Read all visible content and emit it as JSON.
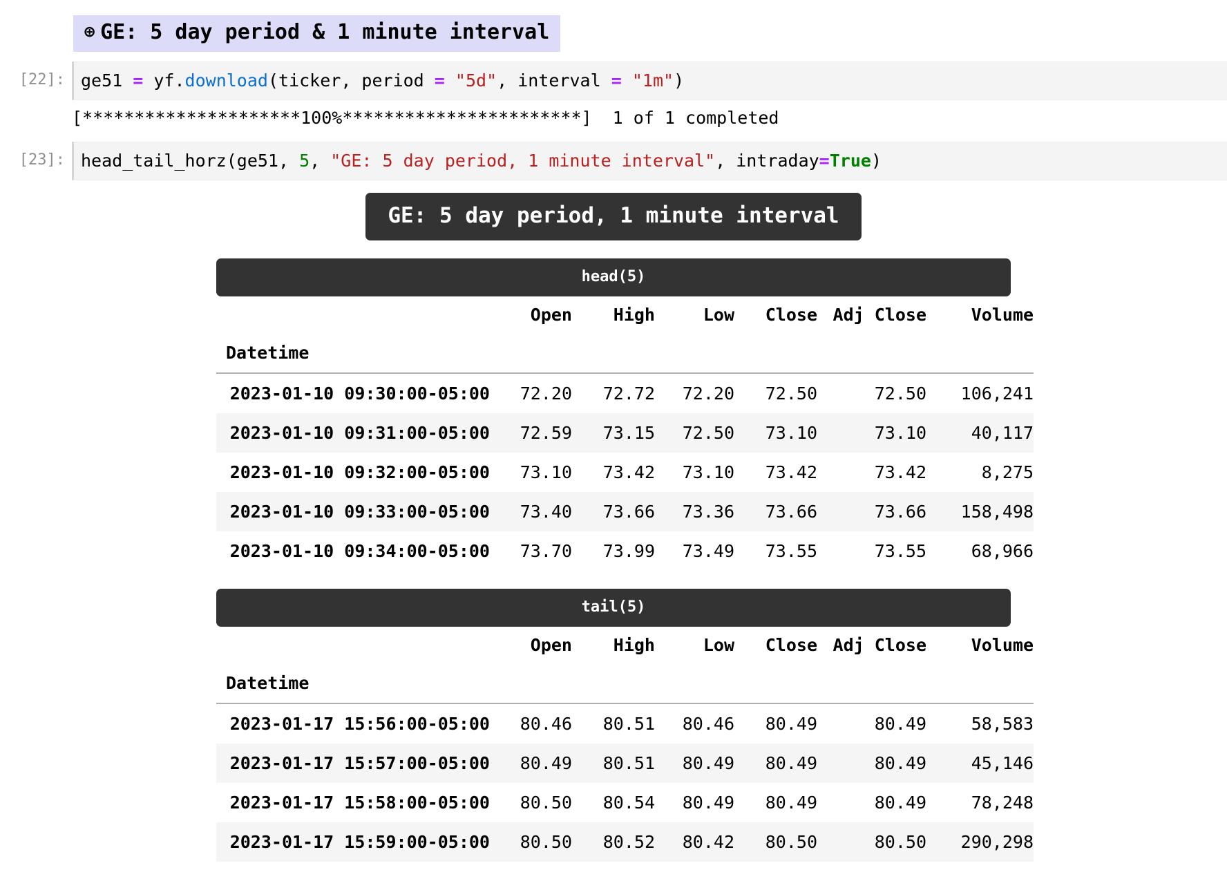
{
  "notebook": {
    "markdown_heading": {
      "icon": "anchor-link-icon",
      "icon_glyph": "⊕",
      "text": "GE: 5 day period & 1 minute interval"
    },
    "cells": [
      {
        "prompt": "[22]:",
        "code_tokens": [
          {
            "t": "ge51 ",
            "c": "plain"
          },
          {
            "t": "=",
            "c": "op"
          },
          {
            "t": " yf.",
            "c": "plain"
          },
          {
            "t": "download",
            "c": "fn"
          },
          {
            "t": "(ticker, period ",
            "c": "plain"
          },
          {
            "t": "=",
            "c": "op"
          },
          {
            "t": " ",
            "c": "plain"
          },
          {
            "t": "\"5d\"",
            "c": "str"
          },
          {
            "t": ", interval ",
            "c": "plain"
          },
          {
            "t": "=",
            "c": "op"
          },
          {
            "t": " ",
            "c": "plain"
          },
          {
            "t": "\"1m\"",
            "c": "str"
          },
          {
            "t": ")",
            "c": "plain"
          }
        ],
        "stdout": "[*********************100%***********************]  1 of 1 completed"
      },
      {
        "prompt": "[23]:",
        "code_tokens": [
          {
            "t": "head_tail_horz(ge51, ",
            "c": "plain"
          },
          {
            "t": "5",
            "c": "num"
          },
          {
            "t": ", ",
            "c": "plain"
          },
          {
            "t": "\"GE: 5 day period, 1 minute interval\"",
            "c": "str"
          },
          {
            "t": ", intraday",
            "c": "plain"
          },
          {
            "t": "=",
            "c": "op"
          },
          {
            "t": "True",
            "c": "kw"
          },
          {
            "t": ")",
            "c": "plain"
          }
        ]
      }
    ]
  },
  "output": {
    "main_title": "GE: 5 day period, 1 minute interval",
    "banner_color": "#333333",
    "stripe_color": "#f5f5f5",
    "index_name": "Datetime",
    "columns": [
      "Open",
      "High",
      "Low",
      "Close",
      "Adj Close",
      "Volume"
    ],
    "tables": [
      {
        "section_label": "head(5)",
        "rows": [
          {
            "index": "2023-01-10 09:30:00-05:00",
            "values": [
              "72.20",
              "72.72",
              "72.20",
              "72.50",
              "72.50",
              "106,241"
            ]
          },
          {
            "index": "2023-01-10 09:31:00-05:00",
            "values": [
              "72.59",
              "73.15",
              "72.50",
              "73.10",
              "73.10",
              "40,117"
            ]
          },
          {
            "index": "2023-01-10 09:32:00-05:00",
            "values": [
              "73.10",
              "73.42",
              "73.10",
              "73.42",
              "73.42",
              "8,275"
            ]
          },
          {
            "index": "2023-01-10 09:33:00-05:00",
            "values": [
              "73.40",
              "73.66",
              "73.36",
              "73.66",
              "73.66",
              "158,498"
            ]
          },
          {
            "index": "2023-01-10 09:34:00-05:00",
            "values": [
              "73.70",
              "73.99",
              "73.49",
              "73.55",
              "73.55",
              "68,966"
            ]
          }
        ]
      },
      {
        "section_label": "tail(5)",
        "rows": [
          {
            "index": "2023-01-17 15:56:00-05:00",
            "values": [
              "80.46",
              "80.51",
              "80.46",
              "80.49",
              "80.49",
              "58,583"
            ]
          },
          {
            "index": "2023-01-17 15:57:00-05:00",
            "values": [
              "80.49",
              "80.51",
              "80.49",
              "80.49",
              "80.49",
              "45,146"
            ]
          },
          {
            "index": "2023-01-17 15:58:00-05:00",
            "values": [
              "80.50",
              "80.54",
              "80.49",
              "80.49",
              "80.49",
              "78,248"
            ]
          },
          {
            "index": "2023-01-17 15:59:00-05:00",
            "values": [
              "80.50",
              "80.52",
              "80.42",
              "80.50",
              "80.50",
              "290,298"
            ]
          }
        ]
      }
    ]
  }
}
